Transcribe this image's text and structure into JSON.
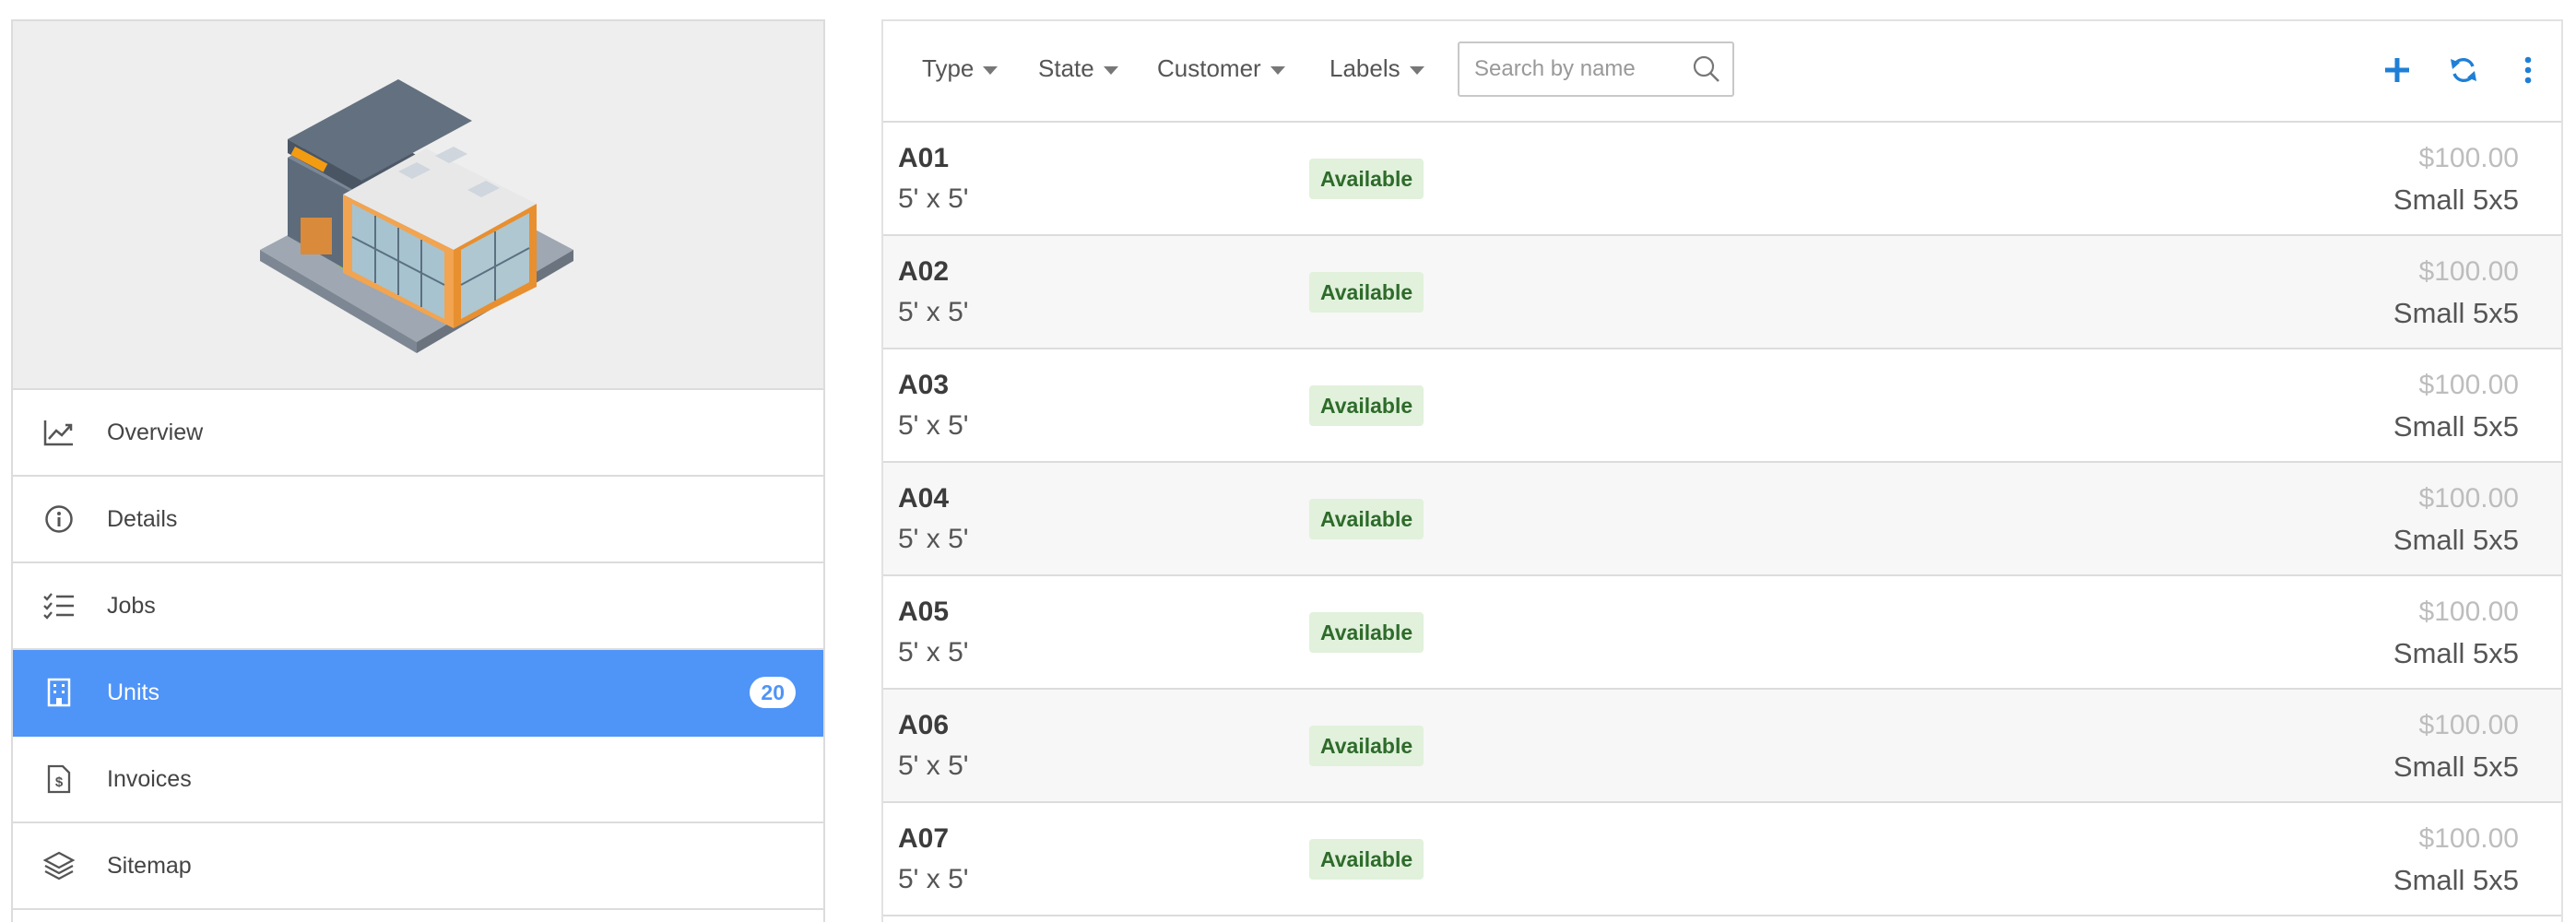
{
  "sidebar": {
    "items": [
      {
        "label": "Overview",
        "icon": "chart-line-icon"
      },
      {
        "label": "Details",
        "icon": "info-circle-icon"
      },
      {
        "label": "Jobs",
        "icon": "checklist-icon"
      },
      {
        "label": "Units",
        "icon": "building-icon",
        "badge": "20"
      },
      {
        "label": "Invoices",
        "icon": "invoice-icon"
      },
      {
        "label": "Sitemap",
        "icon": "layers-icon"
      }
    ]
  },
  "hero": {
    "image": "storage-building-illustration"
  },
  "toolbar": {
    "filters": [
      "Type",
      "State",
      "Customer",
      "Labels"
    ],
    "search_placeholder": "Search by name",
    "actions": [
      "plus-icon",
      "refresh-icon",
      "more-vertical-icon"
    ]
  },
  "units": [
    {
      "name": "A01",
      "size": "5' x 5'",
      "status": "Available",
      "price": "$100.00",
      "type": "Small 5x5"
    },
    {
      "name": "A02",
      "size": "5' x 5'",
      "status": "Available",
      "price": "$100.00",
      "type": "Small 5x5"
    },
    {
      "name": "A03",
      "size": "5' x 5'",
      "status": "Available",
      "price": "$100.00",
      "type": "Small 5x5"
    },
    {
      "name": "A04",
      "size": "5' x 5'",
      "status": "Available",
      "price": "$100.00",
      "type": "Small 5x5"
    },
    {
      "name": "A05",
      "size": "5' x 5'",
      "status": "Available",
      "price": "$100.00",
      "type": "Small 5x5"
    },
    {
      "name": "A06",
      "size": "5' x 5'",
      "status": "Available",
      "price": "$100.00",
      "type": "Small 5x5"
    },
    {
      "name": "A07",
      "size": "5' x 5'",
      "status": "Available",
      "price": "$100.00",
      "type": "Small 5x5"
    }
  ],
  "colors": {
    "accent": "#4f94f7",
    "action": "#1f7fd6",
    "status_bg": "#e1f1dc",
    "status_text": "#2e6b2a"
  }
}
